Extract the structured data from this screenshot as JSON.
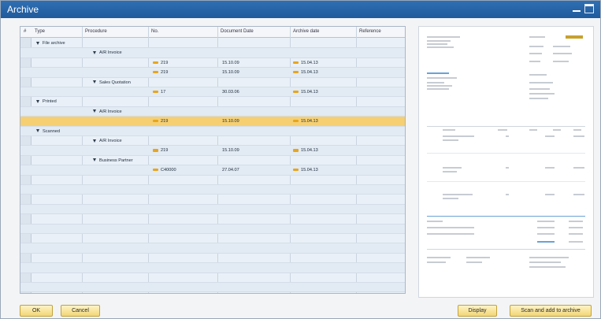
{
  "window": {
    "title": "Archive"
  },
  "grid": {
    "columns": [
      "#",
      "Type",
      "Procedure",
      "No.",
      "Document Date",
      "Archive date",
      "Reference"
    ],
    "rows": [
      {
        "type": "File archive",
        "procedure": "",
        "no": "",
        "document_date": "",
        "archive_date": "",
        "level": 0
      },
      {
        "type": "",
        "procedure": "A/R Invoice",
        "no": "",
        "document_date": "",
        "archive_date": "",
        "level": 1
      },
      {
        "type": "",
        "procedure": "",
        "no": "219",
        "document_date": "15.10.09",
        "archive_date": "15.04.13",
        "level": 2
      },
      {
        "type": "",
        "procedure": "",
        "no": "219",
        "document_date": "15.10.09",
        "archive_date": "15.04.13",
        "level": 2
      },
      {
        "type": "",
        "procedure": "Sales Quotation",
        "no": "",
        "document_date": "",
        "archive_date": "",
        "level": 1
      },
      {
        "type": "",
        "procedure": "",
        "no": "17",
        "document_date": "30.03.06",
        "archive_date": "15.04.13",
        "level": 2
      },
      {
        "type": "Printed",
        "procedure": "",
        "no": "",
        "document_date": "",
        "archive_date": "",
        "level": 0
      },
      {
        "type": "",
        "procedure": "A/R Invoice",
        "no": "",
        "document_date": "",
        "archive_date": "",
        "level": 1
      },
      {
        "type": "",
        "procedure": "",
        "no": "219",
        "document_date": "15.10.09",
        "archive_date": "15.04.13",
        "level": 2,
        "selected": true
      },
      {
        "type": "Scanned",
        "procedure": "",
        "no": "",
        "document_date": "",
        "archive_date": "",
        "level": 0
      },
      {
        "type": "",
        "procedure": "A/R Invoice",
        "no": "",
        "document_date": "",
        "archive_date": "",
        "level": 1
      },
      {
        "type": "",
        "procedure": "",
        "no": "219",
        "document_date": "15.10.09",
        "archive_date": "15.04.13",
        "level": 2
      },
      {
        "type": "",
        "procedure": "Business Partner",
        "no": "",
        "document_date": "",
        "archive_date": "",
        "level": 1
      },
      {
        "type": "",
        "procedure": "",
        "no": "C40000",
        "document_date": "27.04.07",
        "archive_date": "15.04.13",
        "level": 2
      }
    ],
    "empty_rows": 13
  },
  "buttons": {
    "ok": "OK",
    "cancel": "Cancel",
    "display": "Display",
    "scan": "Scan and add to archive"
  },
  "colors": {
    "title_bar": "#1f5a9c",
    "selected_row": "#f5cf72",
    "grid_bg": "#e9f0f7",
    "button_face": "#f2d777",
    "folder_icon": "#e8a51c"
  }
}
